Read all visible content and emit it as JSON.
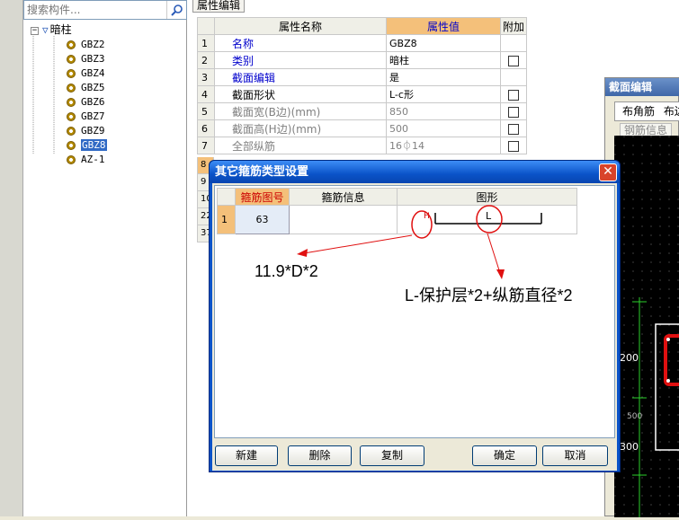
{
  "search": {
    "placeholder": "搜索构件..."
  },
  "tree": {
    "root_label": "暗柱",
    "items": [
      "GBZ2",
      "GBZ3",
      "GBZ4",
      "GBZ5",
      "GBZ6",
      "GBZ7",
      "GBZ9",
      "GBZ8",
      "AZ-1"
    ],
    "selected": "GBZ8"
  },
  "property_panel": {
    "tab_label": "属性编辑",
    "headers": {
      "name": "属性名称",
      "value": "属性值",
      "extra": "附加"
    },
    "rows": [
      {
        "num": "1",
        "name": "名称",
        "value": "GBZ8",
        "checkbox": false
      },
      {
        "num": "2",
        "name": "类别",
        "value": "暗柱",
        "checkbox": true
      },
      {
        "num": "3",
        "name": "截面编辑",
        "value": "是",
        "checkbox": false
      },
      {
        "num": "4",
        "name": "截面形状",
        "value": "L-c形",
        "checkbox": true
      },
      {
        "num": "5",
        "name": "截面宽(B边)(mm)",
        "value": "850",
        "checkbox": true
      },
      {
        "num": "6",
        "name": "截面高(H边)(mm)",
        "value": "500",
        "checkbox": true
      },
      {
        "num": "7",
        "name": "全部纵筋",
        "value": "16⏀14",
        "checkbox": true
      }
    ],
    "partial_row_numbers": [
      "8",
      "9",
      "10",
      "22",
      "37"
    ]
  },
  "section_editor": {
    "title": "截面编辑",
    "toolbar": [
      "布角筋",
      "布边"
    ],
    "tab": "钢筋信息",
    "dims": [
      "200",
      "500",
      "300"
    ]
  },
  "dialog": {
    "title": "其它箍筋类型设置",
    "close_label": "✕",
    "headers": {
      "code": "箍筋图号",
      "info": "箍筋信息",
      "shape": "图形"
    },
    "rows": [
      {
        "num": "1",
        "code": "63",
        "info": ""
      }
    ],
    "shape_labels": {
      "hook": "H",
      "length": "L"
    },
    "buttons": {
      "new": "新建",
      "delete": "删除",
      "copy": "复制",
      "ok": "确定",
      "cancel": "取消"
    }
  },
  "annotations": {
    "hook_formula": "11.9*D*2",
    "length_formula": "L-保护层*2+纵筋直径*2"
  }
}
